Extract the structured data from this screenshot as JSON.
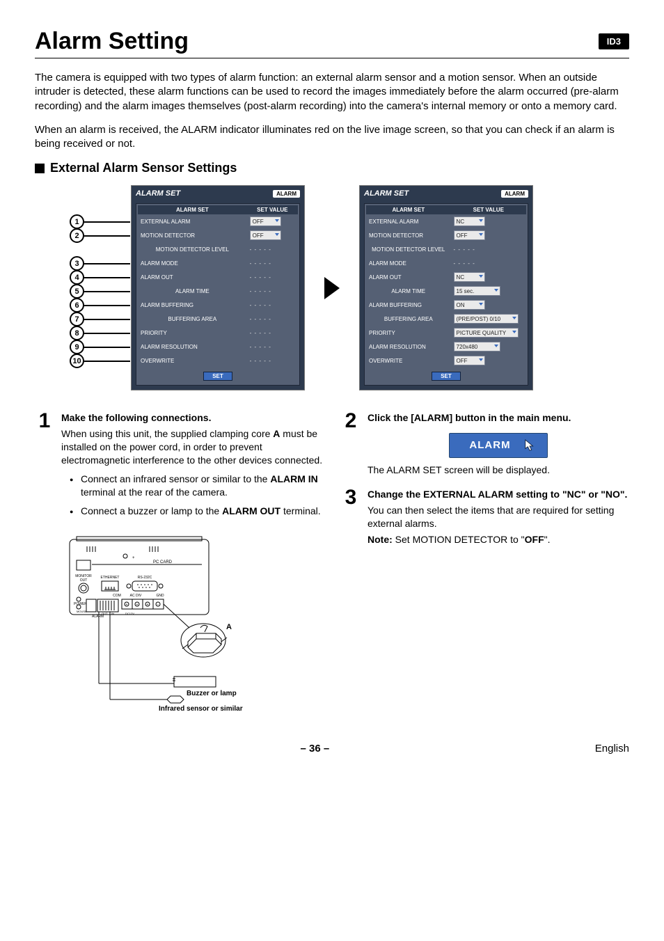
{
  "id_badge": "ID3",
  "title": "Alarm Setting",
  "intro1": "The camera is equipped with two types of alarm function: an external alarm sensor and a motion sensor. When an outside intruder is detected, these alarm functions can be used to record the images immediately before the alarm occurred (pre-alarm recording) and the alarm images themselves (post-alarm recording) into the camera's internal memory or onto a memory card.",
  "intro2": "When an alarm is received, the ALARM indicator illuminates red on the live image screen, so that you can check if an alarm is being received or not.",
  "section_title": "External Alarm Sensor Settings",
  "shot_title": "ALARM SET",
  "shot_badge": "ALARM",
  "headers": {
    "col1": "ALARM SET",
    "col2": "SET VALUE"
  },
  "rows": [
    {
      "label": "EXTERNAL ALARM",
      "sub": false,
      "left": "OFF",
      "right": "NC"
    },
    {
      "label": "MOTION DETECTOR",
      "sub": false,
      "left": "OFF",
      "right": "OFF"
    },
    {
      "label": "MOTION DETECTOR LEVEL",
      "sub": true,
      "left": "dots",
      "right": "dots"
    },
    {
      "label": "ALARM MODE",
      "sub": false,
      "left": "dots",
      "right": "dots"
    },
    {
      "label": "ALARM OUT",
      "sub": false,
      "left": "dots",
      "right": "NC"
    },
    {
      "label": "ALARM TIME",
      "sub": true,
      "left": "dots",
      "right": "15 sec."
    },
    {
      "label": "ALARM BUFFERING",
      "sub": false,
      "left": "dots",
      "right": "ON"
    },
    {
      "label": "BUFFERING AREA",
      "sub": true,
      "left": "dots",
      "right": "(PRE/POST) 0/10"
    },
    {
      "label": "PRIORITY",
      "sub": false,
      "left": "dots",
      "right": "PICTURE QUALITY"
    },
    {
      "label": "ALARM RESOLUTION",
      "sub": false,
      "left": "dots",
      "right": "720x480"
    },
    {
      "label": "OVERWRITE",
      "sub": false,
      "left": "dots",
      "right": "OFF"
    }
  ],
  "set_btn": "SET",
  "callouts": [
    "1",
    "2",
    "3",
    "4",
    "5",
    "6",
    "7",
    "8",
    "9",
    "10"
  ],
  "step1": {
    "num": "1",
    "title": "Make the following connections.",
    "p1_a": "When using this unit, the supplied clamping core ",
    "p1_bold": "A",
    "p1_b": " must be installed on the power cord, in order to prevent electromagnetic interference to the other devices connected.",
    "b1_a": "Connect an infrared sensor or similar to the ",
    "b1_bold": "ALARM IN",
    "b1_b": " terminal at the rear of the camera.",
    "b2_a": "Connect a buzzer or lamp to the ",
    "b2_bold": "ALARM OUT",
    "b2_b": " terminal."
  },
  "diagram_labels": {
    "pc_card": "PC CARD",
    "monitor_out": "MONITOR\nOUT",
    "ethernet": "ETHERNET",
    "rs232c": "RS-232C",
    "com": "COM",
    "acdiv": "AC DIV",
    "gnd": "GND",
    "power": "POWER",
    "mouse": "MOUSE",
    "alarm": "ALARM",
    "dc12v": "DC12V",
    "out": "OUT",
    "in": "IN",
    "a": "A",
    "buzzer": "Buzzer or lamp",
    "sensor": "Infrared sensor or similar"
  },
  "step2": {
    "num": "2",
    "title": "Click the [ALARM] button in the main menu.",
    "button": "ALARM",
    "after": "The ALARM SET screen will be displayed."
  },
  "step3": {
    "num": "3",
    "title": "Change the EXTERNAL ALARM setting to \"NC\" or \"NO\".",
    "p1": "You can then select the items that are required for setting external alarms.",
    "note_label": "Note:",
    "note_a": " Set MOTION DETECTOR to \"",
    "note_bold": "OFF",
    "note_b": "\"."
  },
  "footer": {
    "page": "– 36 –",
    "lang": "English"
  }
}
